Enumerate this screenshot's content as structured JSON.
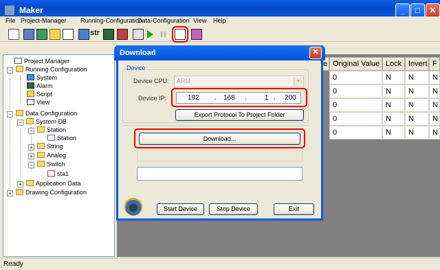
{
  "window": {
    "title": "Maker",
    "min": "_",
    "max": "□",
    "close": "✕"
  },
  "menu": [
    "File",
    "Project-Manager",
    "Running-Configuration",
    "Data-Configuration",
    "View",
    "Help"
  ],
  "toolbar": {
    "str_label": "str",
    "icons": [
      "new-icon",
      "monitor-icon",
      "screen-icon",
      "lock-icon",
      "export-icon",
      "tree-icon",
      "string-icon",
      "image-icon",
      "layers-icon",
      "chart-icon",
      "run-icon",
      "pause-icon",
      "download-icon",
      "eraser-icon"
    ]
  },
  "tree": {
    "items": [
      {
        "label": "Project Manager"
      },
      {
        "label": "Running Configuration"
      },
      {
        "label": "System"
      },
      {
        "label": "Alarm"
      },
      {
        "label": "Script"
      },
      {
        "label": "View"
      },
      {
        "label": "Data Configuration"
      },
      {
        "label": "System DB"
      },
      {
        "label": "Station"
      },
      {
        "label": "Station"
      },
      {
        "label": "String"
      },
      {
        "label": "Analog"
      },
      {
        "label": "Switch"
      },
      {
        "label": "sta1"
      },
      {
        "label": "Application Data"
      },
      {
        "label": "Drawing Configuration"
      }
    ],
    "expander_minus": "−",
    "expander_plus": "+"
  },
  "grid": {
    "headers": [
      "e",
      "Original Value",
      "Lock",
      "Invert",
      "F"
    ],
    "rows": [
      [
        "0",
        "N",
        "N",
        "N"
      ],
      [
        "0",
        "N",
        "N",
        "N"
      ],
      [
        "0",
        "N",
        "N",
        "N"
      ],
      [
        "0",
        "N",
        "N",
        "N"
      ],
      [
        "0",
        "N",
        "N",
        "N"
      ]
    ]
  },
  "status": "Ready",
  "dialog": {
    "title": "Download",
    "close": "✕",
    "group_label": "Device",
    "cpu_label": "Device CPU:",
    "cpu_value": "ARM",
    "cpu_arrow": "▼",
    "ip_label": "Device IP:",
    "ip": [
      "192",
      "168",
      "1",
      "200"
    ],
    "ip_dot": ".",
    "export_button": "Export Protocol To Project Folder",
    "download_button": "Download...",
    "start_button": "Start Device",
    "stop_button": "Stop Device",
    "exit_button": "Exit"
  },
  "colors": {
    "highlight": "#e00000",
    "titlebar": "#0a5ae0"
  }
}
